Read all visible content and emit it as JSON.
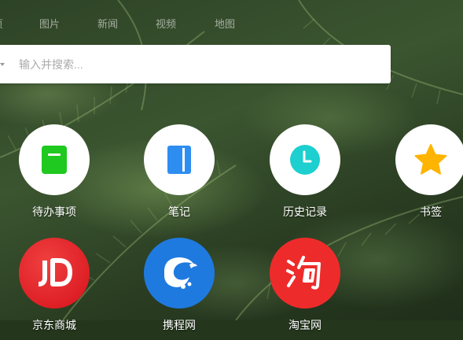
{
  "search_tabs": [
    {
      "label": "网页"
    },
    {
      "label": "图片"
    },
    {
      "label": "新闻"
    },
    {
      "label": "视频"
    },
    {
      "label": "地图"
    }
  ],
  "search": {
    "placeholder": "输入并搜索..."
  },
  "shortcuts": [
    {
      "label": "待办事项",
      "icon": "todo-icon",
      "color": "#1fc91f"
    },
    {
      "label": "笔记",
      "icon": "notes-icon",
      "color": "#2e8df0"
    },
    {
      "label": "历史记录",
      "icon": "clock-icon",
      "color": "#1dcfcf"
    },
    {
      "label": "书签",
      "icon": "star-icon",
      "color": "#ffb400"
    },
    {
      "label": "京东商城",
      "icon": "jd-logo-icon",
      "color": "#e21b23"
    },
    {
      "label": "携程网",
      "icon": "ctrip-dolphin-icon",
      "color": "#1f7ae0"
    },
    {
      "label": "淘宝网",
      "icon": "taobao-logo-icon",
      "color": "#ee2b2b"
    }
  ]
}
